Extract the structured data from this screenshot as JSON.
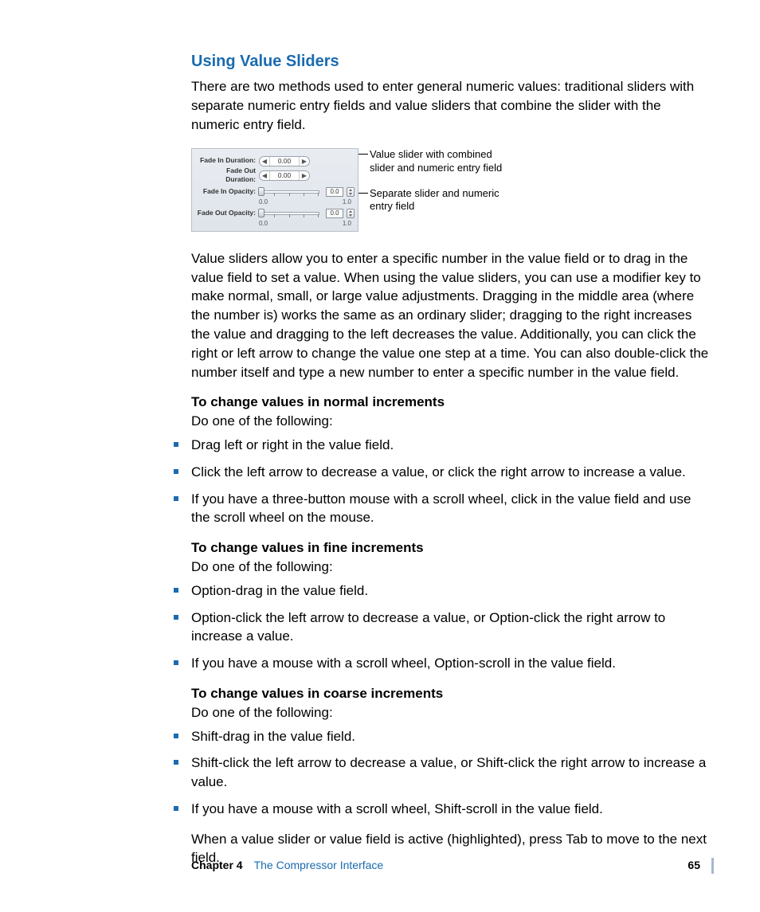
{
  "heading": "Using Value Sliders",
  "intro": "There are two methods used to enter general numeric values: traditional sliders with separate numeric entry fields and value sliders that combine the slider with the numeric entry field.",
  "figure": {
    "rows": {
      "fade_in_duration": {
        "label": "Fade In Duration:",
        "value": "0.00"
      },
      "fade_out_duration": {
        "label": "Fade Out Duration:",
        "value": "0.00"
      },
      "fade_in_opacity": {
        "label": "Fade In Opacity:",
        "value": "0.0",
        "min": "0.0",
        "max": "1.0"
      },
      "fade_out_opacity": {
        "label": "Fade Out Opacity:",
        "value": "0.0",
        "min": "0.0",
        "max": "1.0"
      }
    }
  },
  "callouts": {
    "c1": "Value slider with combined slider and numeric entry field",
    "c2": "Separate slider and numeric entry field"
  },
  "para1": "Value sliders allow you to enter a specific number in the value field or to drag in the value field to set a value. When using the value sliders, you can use a modifier key to make normal, small, or large value adjustments. Dragging in the middle area (where the number is) works the same as an ordinary slider; dragging to the right increases the value and dragging to the left decreases the value. Additionally, you can click the right or left arrow to change the value one step at a time. You can also double-click the number itself and type a new number to enter a specific number in the value field.",
  "normal": {
    "title": "To change values in normal increments",
    "sub": "Do one of the following:",
    "items": [
      "Drag left or right in the value field.",
      "Click the left arrow to decrease a value, or click the right arrow to increase a value.",
      "If you have a three-button mouse with a scroll wheel, click in the value field and use the scroll wheel on the mouse."
    ]
  },
  "fine": {
    "title": "To change values in fine increments",
    "sub": "Do one of the following:",
    "items": [
      "Option-drag in the value field.",
      "Option-click the left arrow to decrease a value, or Option-click the right arrow to increase a value.",
      "If you have a mouse with a scroll wheel, Option-scroll in the value field."
    ]
  },
  "coarse": {
    "title": "To change values in coarse increments",
    "sub": "Do one of the following:",
    "items": [
      "Shift-drag in the value field.",
      "Shift-click the left arrow to decrease a value, or Shift-click the right arrow to increase a value.",
      "If you have a mouse with a scroll wheel, Shift-scroll in the value field."
    ]
  },
  "closing": "When a value slider or value field is active (highlighted), press Tab to move to the next field.",
  "footer": {
    "chapter": "Chapter 4",
    "title": "The Compressor Interface",
    "page": "65"
  }
}
